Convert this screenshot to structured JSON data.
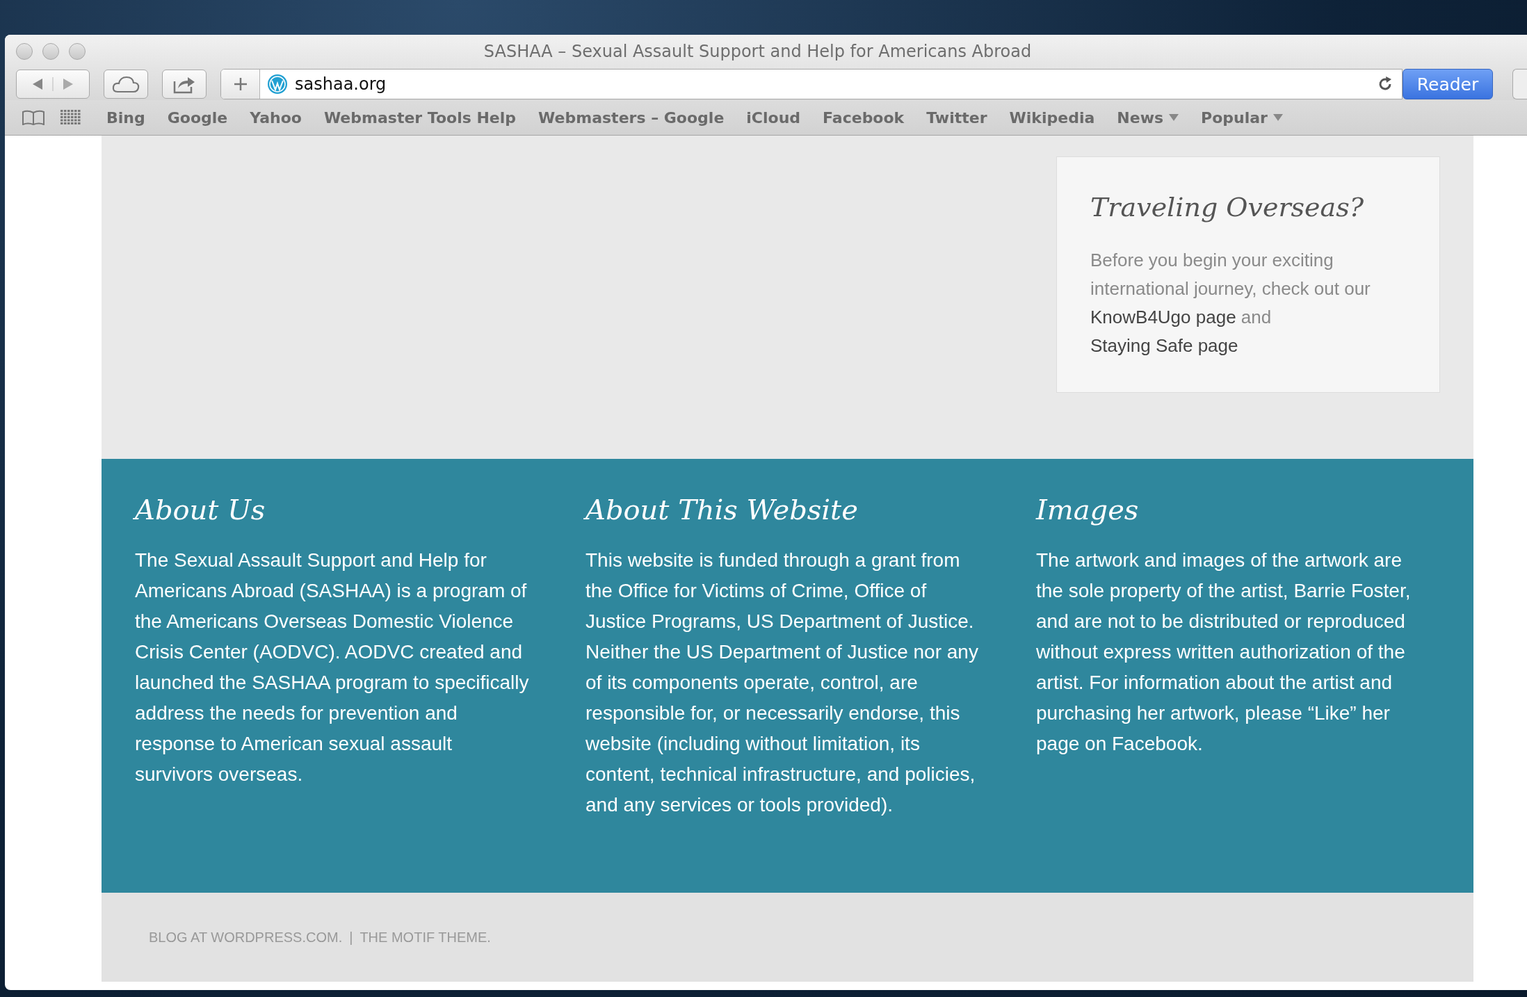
{
  "window": {
    "title": "SASHAA – Sexual Assault Support and Help for Americans Abroad"
  },
  "toolbar": {
    "url": "sashaa.org",
    "reader_button": "Reader"
  },
  "bookmarks": [
    {
      "label": "Bing",
      "kind": "link"
    },
    {
      "label": "Google",
      "kind": "link"
    },
    {
      "label": "Yahoo",
      "kind": "link"
    },
    {
      "label": "Webmaster Tools Help",
      "kind": "link"
    },
    {
      "label": "Webmasters – Google",
      "kind": "link"
    },
    {
      "label": "iCloud",
      "kind": "link"
    },
    {
      "label": "Facebook",
      "kind": "link"
    },
    {
      "label": "Twitter",
      "kind": "link"
    },
    {
      "label": "Wikipedia",
      "kind": "link"
    },
    {
      "label": "News",
      "kind": "menu"
    },
    {
      "label": "Popular",
      "kind": "menu"
    }
  ],
  "widget": {
    "title": "Traveling Overseas?",
    "parts": [
      {
        "text": "Before you begin your exciting international journey, check out our ",
        "link": false
      },
      {
        "text": "KnowB4Ugo page",
        "link": true
      },
      {
        "text": " and ",
        "link": false
      },
      {
        "text": "Staying Safe page",
        "link": true
      }
    ]
  },
  "footer_columns": [
    {
      "title": "About Us",
      "text": "The Sexual Assault Support and Help for Americans Abroad (SASHAA) is a program of the Americans Overseas Domestic Violence Crisis Center (AODVC). AODVC created and launched the SASHAA program to specifically address the needs for prevention and response to American sexual assault survivors overseas."
    },
    {
      "title": "About This Website",
      "text": "This website is funded through a grant from the Office for Victims of Crime, Office of Justice Programs, US Department of Justice. Neither the US Department of Justice nor any of its components operate, control, are responsible for, or necessarily endorse, this website (including without limitation, its content, technical infrastructure, and policies, and any services or tools provided)."
    },
    {
      "title": "Images",
      "text": "The artwork and images of the artwork are the sole property of the artist, Barrie Foster, and are not to be distributed or reproduced without express written authorization of the artist. For information about the artist and purchasing her artwork, please “Like” her page on Facebook."
    }
  ],
  "credits": {
    "links": [
      "BLOG AT WORDPRESS.COM.",
      "THE MOTIF THEME."
    ],
    "separator": "|"
  }
}
